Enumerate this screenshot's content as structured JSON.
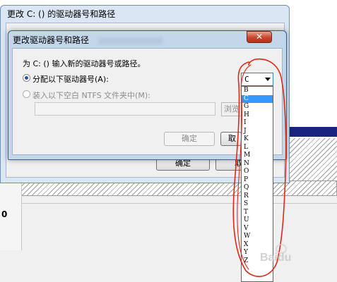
{
  "outer_dialog": {
    "title": "更改 C: () 的驱动器号和路径",
    "ok_label": "确定",
    "cancel_label": "取"
  },
  "inner_dialog": {
    "title": "更改驱动器号和路径",
    "close_label": "✕",
    "prompt": "为 C: () 输入新的驱动器号或路径。",
    "option_assign_letter": "分配以下驱动器号(A):",
    "option_mount_folder": "装入以下空白 NTFS 文件夹中(M):",
    "browse_label": "浏览",
    "ok_label": "确定",
    "cancel_label": "取",
    "selected_option": "assign_letter"
  },
  "drive_select": {
    "value": "C",
    "options": [
      "B",
      "C",
      "G",
      "H",
      "I",
      "J",
      "K",
      "L",
      "M",
      "N",
      "O",
      "P",
      "Q",
      "R",
      "S",
      "T",
      "U",
      "V",
      "W",
      "X",
      "Y",
      "Z"
    ],
    "highlighted": "C"
  },
  "background": {
    "disk_row_label": "0"
  },
  "annotation": {
    "color": "#e0271b"
  },
  "watermark": {
    "text": "Baidu"
  }
}
